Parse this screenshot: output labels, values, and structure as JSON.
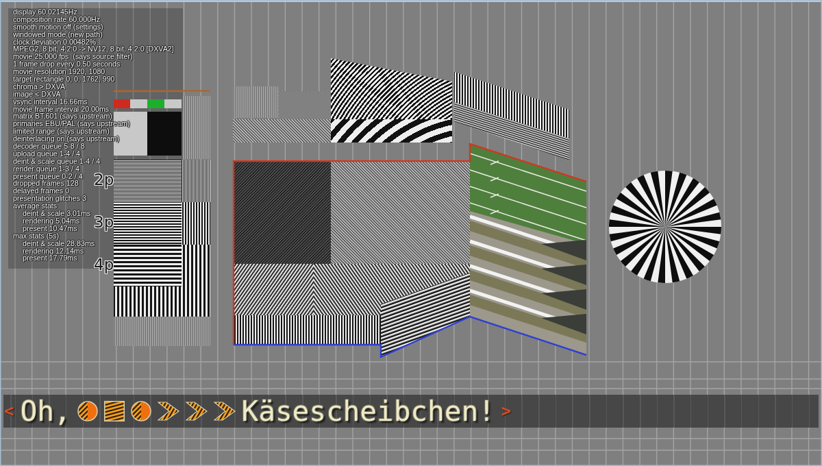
{
  "stats_overlay": {
    "lines": [
      {
        "text": "display 60.02145Hz"
      },
      {
        "text": "composition rate 60.000Hz"
      },
      {
        "text": "smooth motion off (settings)"
      },
      {
        "text": "windowed mode (new path)"
      },
      {
        "text": "clock deviation 0.00482%"
      },
      {
        "text": "MPEG2, 8 bit, 4:2:0 -> NV12, 8 bit, 4:2:0 [DXVA2]"
      },
      {
        "text": "movie 25.000 fps  (says source filter)"
      },
      {
        "text": "1 frame drop every 0.50 seconds"
      },
      {
        "text": "movie resolution 1920, 1080"
      },
      {
        "text": "target rectangle 0, 0, 1762, 990"
      },
      {
        "text": "chroma > DXVA"
      },
      {
        "text": "image < DXVA"
      },
      {
        "text": "vsync interval 16.66ms"
      },
      {
        "text": "movie frame interval 20.00ms"
      },
      {
        "text": "matrix BT.601 (says upstream)"
      },
      {
        "text": "primaries EBU/PAL (says upstream)"
      },
      {
        "text": "limited range (says upstream)"
      },
      {
        "text": "deinterlacing on (says upstream)"
      },
      {
        "text": "decoder queue 5-8 / 8"
      },
      {
        "text": "upload queue 1-4 / 4"
      },
      {
        "text": "deint & scale queue 1-4 / 4"
      },
      {
        "text": "render queue 1-3 / 4"
      },
      {
        "text": "present queue 0-2 / 4"
      },
      {
        "text": "dropped frames 128"
      },
      {
        "text": "delayed frames 0"
      },
      {
        "text": "presentation glitches 3"
      },
      {
        "text": "average stats",
        "children": [
          {
            "text": "deint & scale 3.01ms"
          },
          {
            "text": "rendering 5.04ms"
          },
          {
            "text": "present 10.47ms"
          }
        ]
      },
      {
        "text": "max stats (5s)",
        "children": [
          {
            "text": "deint & scale 28.83ms"
          },
          {
            "text": "rendering 12.14ms"
          },
          {
            "text": "present 17.79ms"
          }
        ]
      }
    ]
  },
  "scale_labels": [
    "2p",
    "3p",
    "4p"
  ],
  "ticker": {
    "left_marker": "<",
    "greeting": "Oh,",
    "word": "Käsescheibchen!",
    "right_marker": ">"
  }
}
